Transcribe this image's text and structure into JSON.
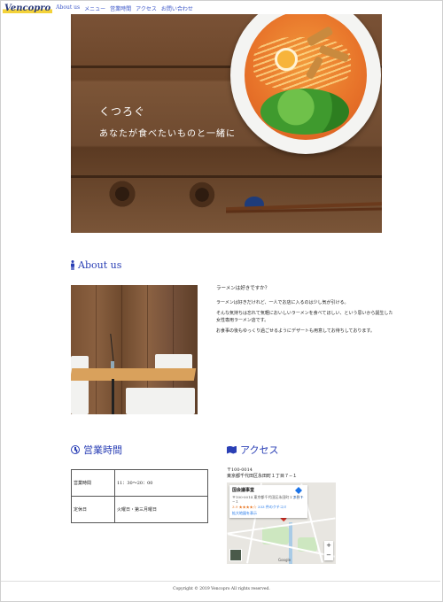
{
  "header": {
    "logo": "Vencopro",
    "nav": [
      "About us",
      "メニュー",
      "営業時間",
      "アクセス",
      "お問い合わせ"
    ]
  },
  "hero": {
    "title": "くつろぐ",
    "subtitle": "あなたが食べたいものと一緒に"
  },
  "about": {
    "heading": "About us",
    "question": "ラーメンは好きですか？",
    "paragraphs": [
      "ラーメンは好きだけれど、一人でお店に入るのは少し気が引ける。",
      "そんな気持ちは忘れて気軽においしいラーメンを食べてほしい、という思いから誕生した女性専用ラーメン店です。",
      "お食事の後もゆっくり過ごせるようにデザートも用意してお待ちしております。"
    ]
  },
  "hours": {
    "heading": "営業時間",
    "rows": [
      {
        "label": "営業時間",
        "value": "11：30〜20：00"
      },
      {
        "label": "定休日",
        "value": "火曜日・第三月曜日"
      }
    ]
  },
  "access": {
    "heading": "アクセス",
    "postal": "〒100-0014",
    "address": "東京都千代田区永田町１丁目７−１",
    "map": {
      "place_name": "国会議事堂",
      "place_address": "〒100-0014 東京都千代田区永田町１丁目７−１",
      "rating": "3.9 ★★★★☆",
      "reviews": "333 件のクチコミ",
      "larger_map": "拡大地図を表示",
      "route": "ルート",
      "zoom_in": "+",
      "zoom_out": "−",
      "brand": "Google"
    }
  },
  "footer": {
    "copyright": "Copyright © 2019 Vencopro All rights reserved."
  },
  "colors": {
    "accent": "#2a3fb5",
    "link": "#3b56c8",
    "logo_highlight": "#f3d23a"
  },
  "icons": {
    "about": "person-icon",
    "hours": "clock-icon",
    "access": "map-icon"
  }
}
